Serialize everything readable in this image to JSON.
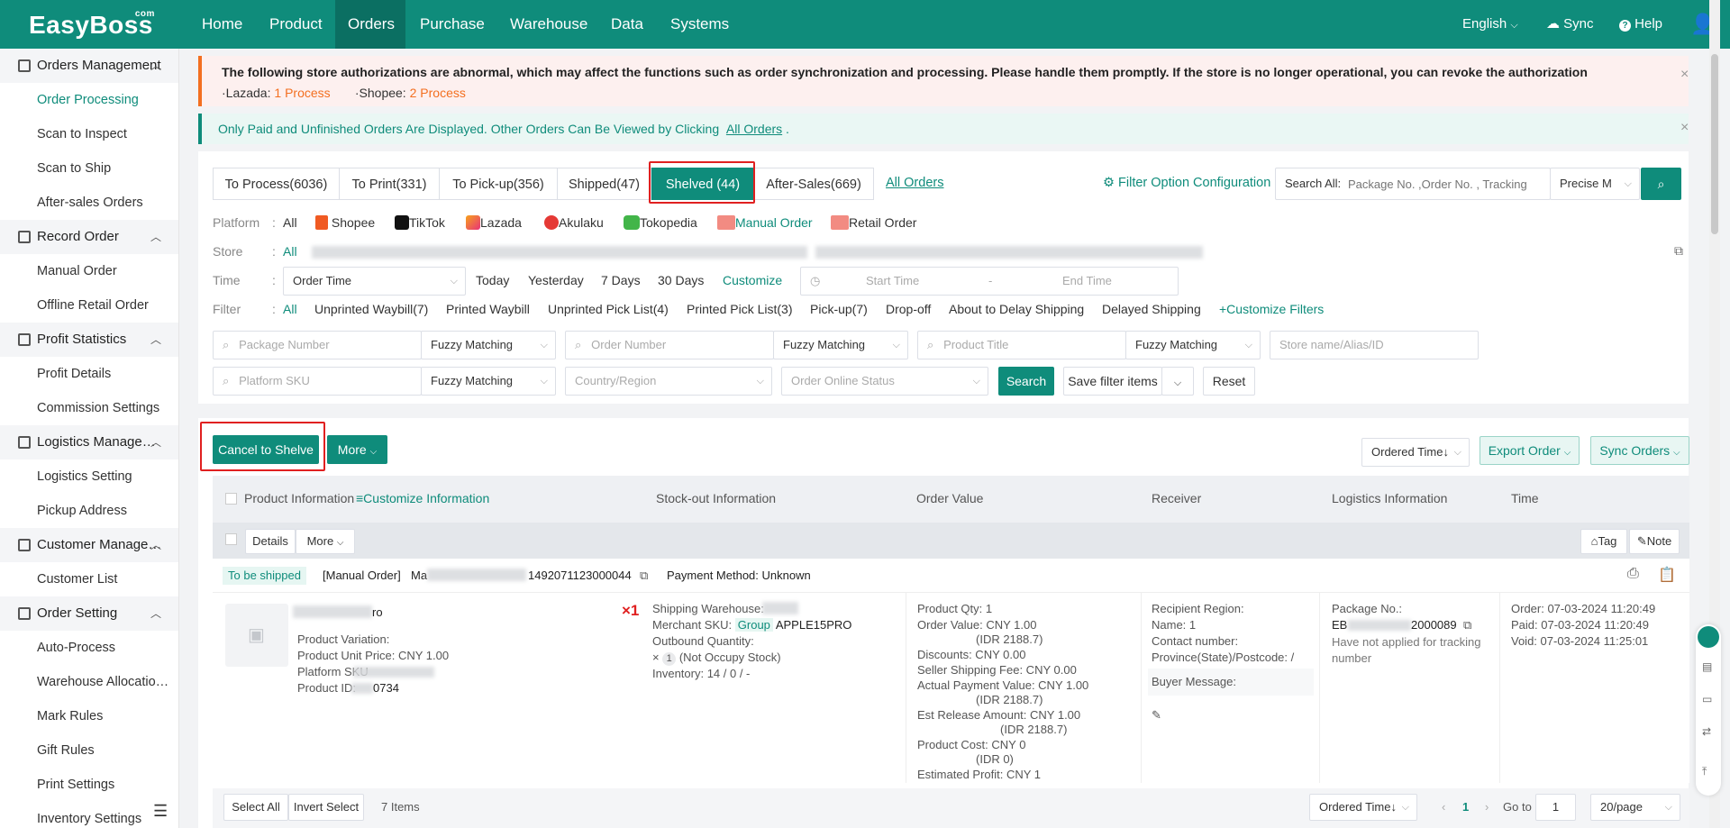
{
  "app": {
    "logo": "EasyBoss",
    "logo_sup": "com"
  },
  "nav": {
    "items": [
      "Home",
      "Product",
      "Orders",
      "Purchase",
      "Warehouse",
      "Data",
      "Systems"
    ],
    "active": "Orders",
    "language": "English",
    "sync": "Sync",
    "help": "Help"
  },
  "sidebar": {
    "groups": [
      {
        "title": "Orders Management",
        "items": [
          "Order Processing",
          "Scan to Inspect",
          "Scan to Ship",
          "After-sales Orders"
        ]
      },
      {
        "title": "Record Order",
        "items": [
          "Manual Order",
          "Offline Retail Order"
        ]
      },
      {
        "title": "Profit Statistics",
        "items": [
          "Profit Details",
          "Commission Settings"
        ]
      },
      {
        "title": "Logistics Manage…",
        "items": [
          "Logistics Setting",
          "Pickup Address"
        ]
      },
      {
        "title": "Customer Manage…",
        "items": [
          "Customer List"
        ]
      },
      {
        "title": "Order Setting",
        "items": [
          "Auto-Process",
          "Warehouse Allocatio…",
          "Mark Rules",
          "Gift Rules",
          "Print Settings",
          "Inventory Settings"
        ]
      }
    ],
    "active_item": "Order Processing"
  },
  "alert": {
    "text": "The following store authorizations are abnormal, which may affect the functions such as order synchronization and processing. Please handle them promptly. If the store is no longer operational, you can revoke the authorization",
    "lazada_label": "·Lazada:",
    "lazada_count": "1",
    "lazada_action": "Process",
    "shopee_label": "·Shopee:",
    "shopee_count": "2",
    "shopee_action": "Process"
  },
  "info": {
    "text": "Only Paid and Unfinished Orders Are Displayed. Other Orders Can Be Viewed by Clicking",
    "link": "All Orders",
    "tail": "."
  },
  "tabs": [
    {
      "label": "To Process(6036)"
    },
    {
      "label": "To Print(331)"
    },
    {
      "label": "To Pick-up(356)"
    },
    {
      "label": "Shipped(47)"
    },
    {
      "label": "Shelved (44)",
      "active": true
    },
    {
      "label": "After-Sales(669)"
    }
  ],
  "all_orders_link": "All Orders",
  "filter_config": "Filter Option Configuration",
  "search": {
    "label": "Search All:",
    "placeholder": "Package No. ,Order No. , Tracking",
    "mode": "Precise M"
  },
  "filters": {
    "platform_label": "Platform",
    "platforms": [
      "All",
      "Shopee",
      "TikTok",
      "Lazada",
      "Akulaku",
      "Tokopedia",
      "Manual Order",
      "Retail Order"
    ],
    "store_label": "Store",
    "store_all": "All",
    "time_label": "Time",
    "time_select": "Order Time",
    "time_opts": [
      "Today",
      "Yesterday",
      "7 Days",
      "30 Days",
      "Customize"
    ],
    "start": "Start Time",
    "dash": "-",
    "end": "End Time",
    "filter_label": "Filter",
    "filter_opts": [
      "All",
      "Unprinted Waybill(7)",
      "Printed Waybill",
      "Unprinted Pick List(4)",
      "Printed Pick List(3)",
      "Pick-up(7)",
      "Drop-off",
      "About to Delay Shipping",
      "Delayed Shipping",
      "+Customize Filters"
    ],
    "row1": [
      "Package Number",
      "Fuzzy Matching",
      "Order Number",
      "Fuzzy Matching",
      "Product Title",
      "Fuzzy Matching",
      "Store name/Alias/ID"
    ],
    "row2": [
      "Platform SKU",
      "Fuzzy Matching",
      "Country/Region",
      "Order Online Status"
    ],
    "search_btn": "Search",
    "save_filter": "Save filter items",
    "reset": "Reset"
  },
  "actions": {
    "cancel": "Cancel to Shelve",
    "more": "More",
    "sort": "Ordered Time↓",
    "export": "Export Order",
    "sync_orders": "Sync Orders"
  },
  "table": {
    "headers": [
      "Product Information",
      "Customize Information",
      "Stock-out Information",
      "Order Value",
      "Receiver",
      "Logistics Information",
      "Time"
    ],
    "details": "Details",
    "more": "More",
    "tag": "Tag",
    "note": "Note"
  },
  "order": {
    "status": "To be shipped",
    "source": "[Manual Order]",
    "id_prefix": "Ma",
    "id_suffix": "1492071123000044",
    "payment": "Payment Method: Unknown",
    "product_name_suffix": "ro",
    "variation": "Product Variation:",
    "unit_price": "Product Unit Price:  CNY 1.00",
    "platform_sku": "Platform SKU",
    "product_id_label": "Product ID:",
    "product_id_suffix": "0734",
    "qty_badge": "×1",
    "stock": {
      "warehouse": "Shipping Warehouse:",
      "merchant": "Merchant SKU:",
      "group": "Group",
      "sku": "APPLE15PRO",
      "outbound": "Outbound Quantity:",
      "times": "×",
      "one": "1",
      "occupy": "(Not Occupy Stock)",
      "inventory": "Inventory:  14 / 0 / -"
    },
    "value": [
      "Product Qty:  1",
      "Order Value:  CNY 1.00",
      "(IDR 2188.7)",
      "Discounts:  CNY 0.00",
      "Seller Shipping Fee:  CNY 0.00",
      "Actual Payment Value:  CNY 1.00",
      "(IDR 2188.7)",
      "Est Release Amount:  CNY 1.00",
      "(IDR 2188.7)",
      "Product Cost:  CNY 0",
      "(IDR 0)",
      "Estimated Profit:  CNY 1"
    ],
    "receiver": [
      "Recipient Region:",
      "Name:  1",
      "Contact number:",
      "Province(State)/Postcode:  /"
    ],
    "buyer_message": "Buyer Message:",
    "logistics": {
      "package": "Package No.:",
      "pkg_prefix": "EB",
      "pkg_suffix": "2000089",
      "tracking": "Have not applied for tracking number"
    },
    "time": [
      "Order:  07-03-2024 11:20:49",
      "Paid:  07-03-2024 11:20:49",
      "Void:  07-03-2024 11:25:01"
    ]
  },
  "footer": {
    "select_all": "Select All",
    "invert": "Invert Select",
    "count": "7 Items",
    "sort": "Ordered Time↓",
    "page": "1",
    "goto": "Go to",
    "goto_val": "1",
    "per_page": "20/page"
  }
}
